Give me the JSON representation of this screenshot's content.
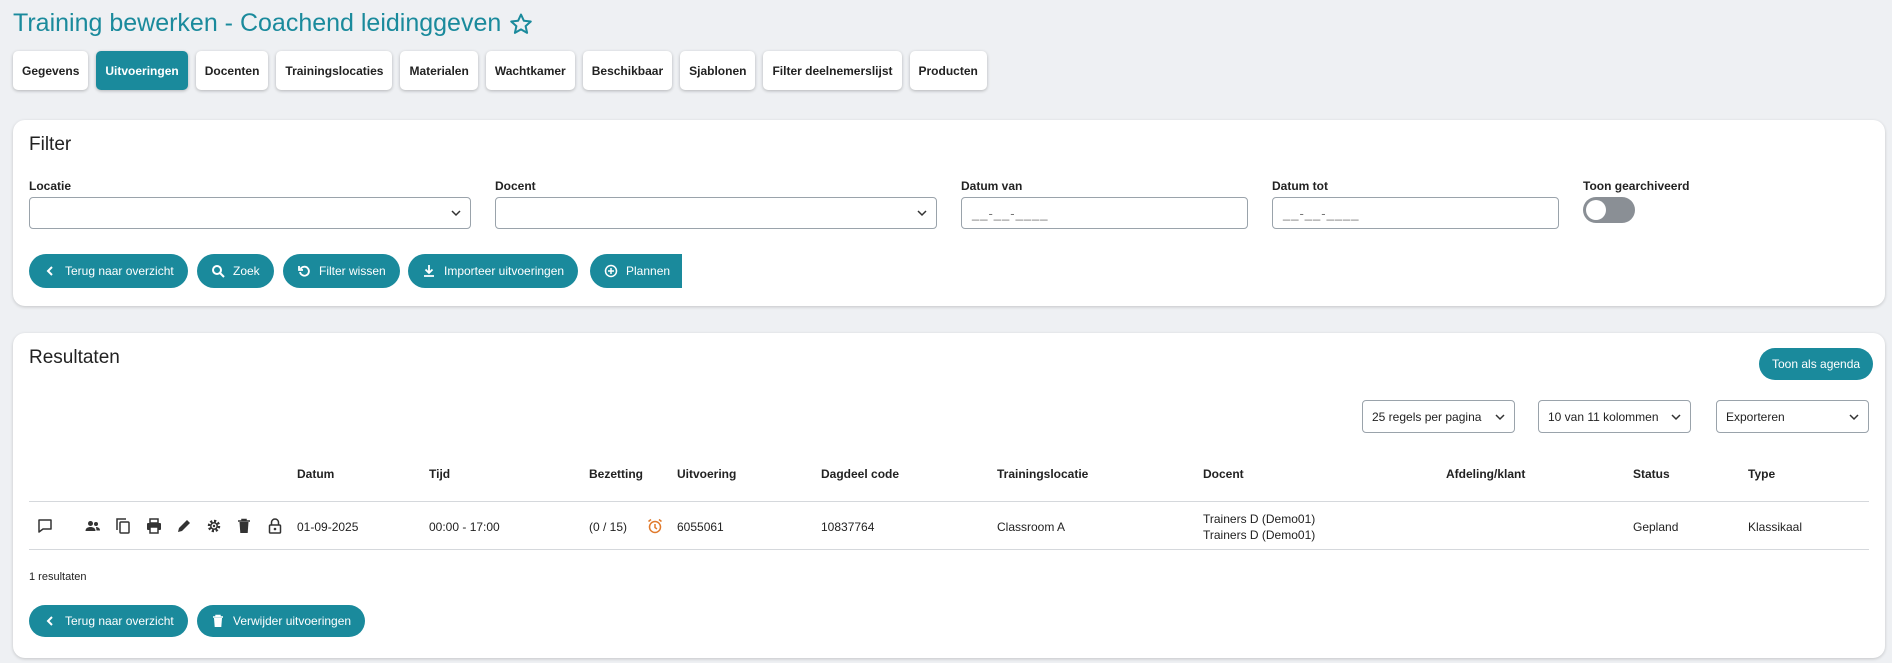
{
  "page": {
    "title": "Training bewerken - Coachend leidinggeven"
  },
  "tabs": [
    {
      "label": "Gegevens",
      "active": false
    },
    {
      "label": "Uitvoeringen",
      "active": true
    },
    {
      "label": "Docenten",
      "active": false
    },
    {
      "label": "Trainingslocaties",
      "active": false
    },
    {
      "label": "Materialen",
      "active": false
    },
    {
      "label": "Wachtkamer",
      "active": false
    },
    {
      "label": "Beschikbaar",
      "active": false
    },
    {
      "label": "Sjablonen",
      "active": false
    },
    {
      "label": "Filter deelnemerslijst",
      "active": false
    },
    {
      "label": "Producten",
      "active": false
    }
  ],
  "filter": {
    "title": "Filter",
    "locatie_label": "Locatie",
    "locatie_value": "",
    "docent_label": "Docent",
    "docent_value": "",
    "datum_van_label": "Datum van",
    "datum_van_mask": "__-__-____",
    "datum_tot_label": "Datum tot",
    "datum_tot_mask": "__-__-____",
    "archived_label": "Toon gearchiveerd",
    "archived_on": false,
    "buttons": {
      "back": "Terug naar overzicht",
      "search": "Zoek",
      "clear": "Filter wissen",
      "import": "Importeer uitvoeringen",
      "plan": "Plannen"
    }
  },
  "results": {
    "title": "Resultaten",
    "agenda_button": "Toon als agenda",
    "per_page": "25 regels per pagina",
    "columns_select": "10 van 11 kolommen",
    "export": "Exporteren",
    "headers": {
      "datum": "Datum",
      "tijd": "Tijd",
      "bezetting": "Bezetting",
      "uitvoering": "Uitvoering",
      "dagdeel": "Dagdeel code",
      "locatie": "Trainingslocatie",
      "docent": "Docent",
      "afdeling": "Afdeling/klant",
      "status": "Status",
      "type": "Type"
    },
    "rows": [
      {
        "datum": "01-09-2025",
        "tijd": "00:00 - 17:00",
        "bezetting": "(0 / 15)",
        "uitvoering": "6055061",
        "dagdeel": "10837764",
        "locatie": "Classroom A",
        "docent_1": "Trainers D (Demo01)",
        "docent_2": "Trainers D (Demo01)",
        "afdeling": "",
        "status": "Gepland",
        "type": "Klassikaal"
      }
    ],
    "count": "1 resultaten",
    "back_button": "Terug naar overzicht",
    "delete_button": "Verwijder uitvoeringen"
  },
  "colors": {
    "accent": "#1a8a9c",
    "alarm": "#e07a2c",
    "background": "#eef0f3"
  }
}
